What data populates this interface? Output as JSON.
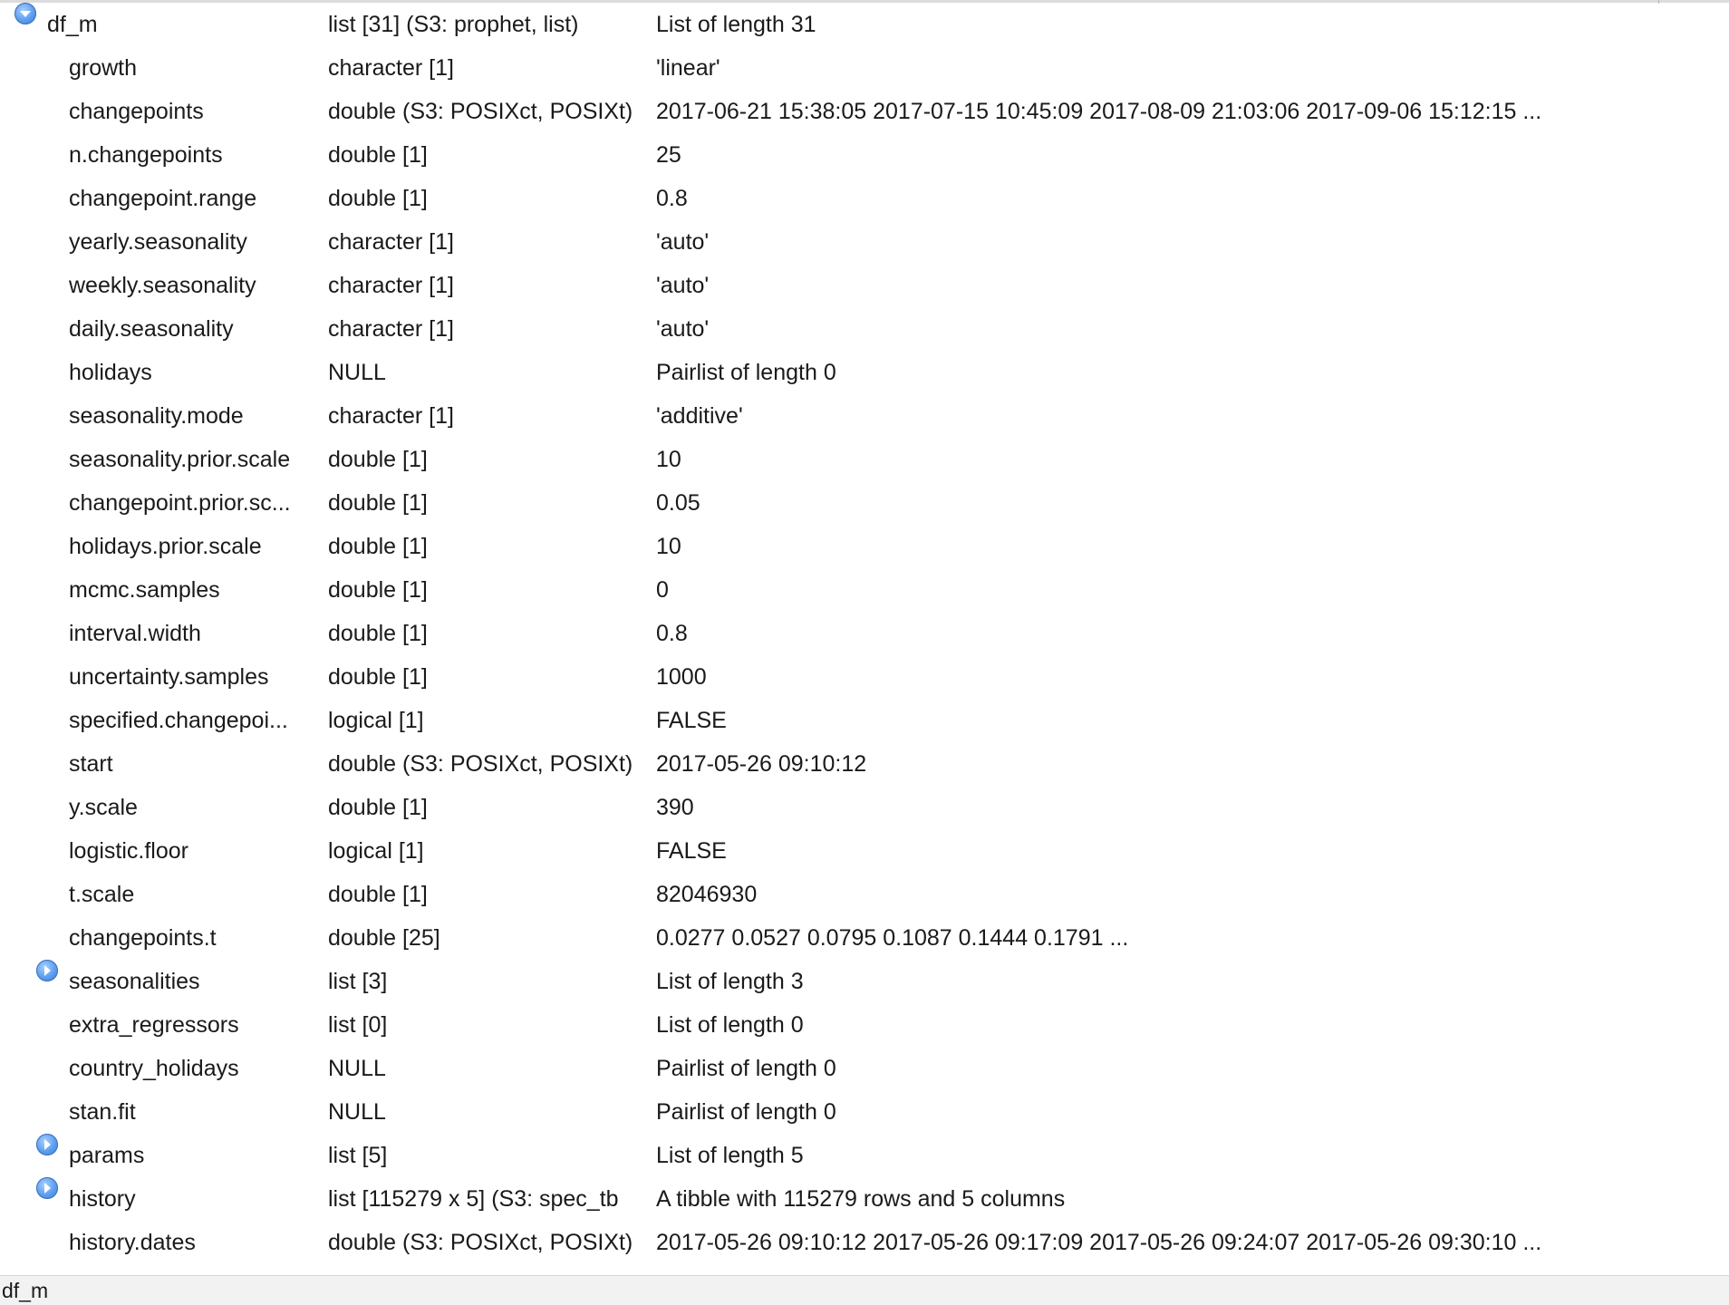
{
  "status_bar": {
    "label": "df_m"
  },
  "root": {
    "name": "df_m",
    "type": "list [31] (S3: prophet, list)",
    "value": "List of length 31",
    "expanded": true
  },
  "items": [
    {
      "name": "growth",
      "type": "character [1]",
      "value": "'linear'"
    },
    {
      "name": "changepoints",
      "type": "double (S3: POSIXct, POSIXt)",
      "value": "2017-06-21 15:38:05 2017-07-15 10:45:09 2017-08-09 21:03:06 2017-09-06 15:12:15 ..."
    },
    {
      "name": "n.changepoints",
      "type": "double [1]",
      "value": "25"
    },
    {
      "name": "changepoint.range",
      "type": "double [1]",
      "value": "0.8"
    },
    {
      "name": "yearly.seasonality",
      "type": "character [1]",
      "value": "'auto'"
    },
    {
      "name": "weekly.seasonality",
      "type": "character [1]",
      "value": "'auto'"
    },
    {
      "name": "daily.seasonality",
      "type": "character [1]",
      "value": "'auto'"
    },
    {
      "name": "holidays",
      "type": "NULL",
      "value": "Pairlist of length 0"
    },
    {
      "name": "seasonality.mode",
      "type": "character [1]",
      "value": "'additive'"
    },
    {
      "name": "seasonality.prior.scale",
      "type": "double [1]",
      "value": "10"
    },
    {
      "name": "changepoint.prior.sc...",
      "type": "double [1]",
      "value": "0.05"
    },
    {
      "name": "holidays.prior.scale",
      "type": "double [1]",
      "value": "10"
    },
    {
      "name": "mcmc.samples",
      "type": "double [1]",
      "value": "0"
    },
    {
      "name": "interval.width",
      "type": "double [1]",
      "value": "0.8"
    },
    {
      "name": "uncertainty.samples",
      "type": "double [1]",
      "value": "1000"
    },
    {
      "name": "specified.changepoi...",
      "type": "logical [1]",
      "value": "FALSE"
    },
    {
      "name": "start",
      "type": "double (S3: POSIXct, POSIXt)",
      "value": "2017-05-26 09:10:12"
    },
    {
      "name": "y.scale",
      "type": "double [1]",
      "value": "390"
    },
    {
      "name": "logistic.floor",
      "type": "logical [1]",
      "value": "FALSE"
    },
    {
      "name": "t.scale",
      "type": "double [1]",
      "value": "82046930"
    },
    {
      "name": "changepoints.t",
      "type": "double [25]",
      "value": "0.0277 0.0527 0.0795 0.1087 0.1444 0.1791 ..."
    },
    {
      "name": "seasonalities",
      "type": "list [3]",
      "value": "List of length 3",
      "expandable": true
    },
    {
      "name": "extra_regressors",
      "type": "list [0]",
      "value": "List of length 0"
    },
    {
      "name": "country_holidays",
      "type": "NULL",
      "value": "Pairlist of length 0"
    },
    {
      "name": "stan.fit",
      "type": "NULL",
      "value": "Pairlist of length 0"
    },
    {
      "name": "params",
      "type": "list [5]",
      "value": "List of length 5",
      "expandable": true
    },
    {
      "name": "history",
      "type": "list [115279 x 5] (S3: spec_tb",
      "value": "A tibble with 115279 rows and 5 columns",
      "expandable": true
    },
    {
      "name": "history.dates",
      "type": "double (S3: POSIXct, POSIXt)",
      "value": "2017-05-26 09:10:12 2017-05-26 09:17:09 2017-05-26 09:24:07 2017-05-26 09:30:10 ..."
    }
  ]
}
